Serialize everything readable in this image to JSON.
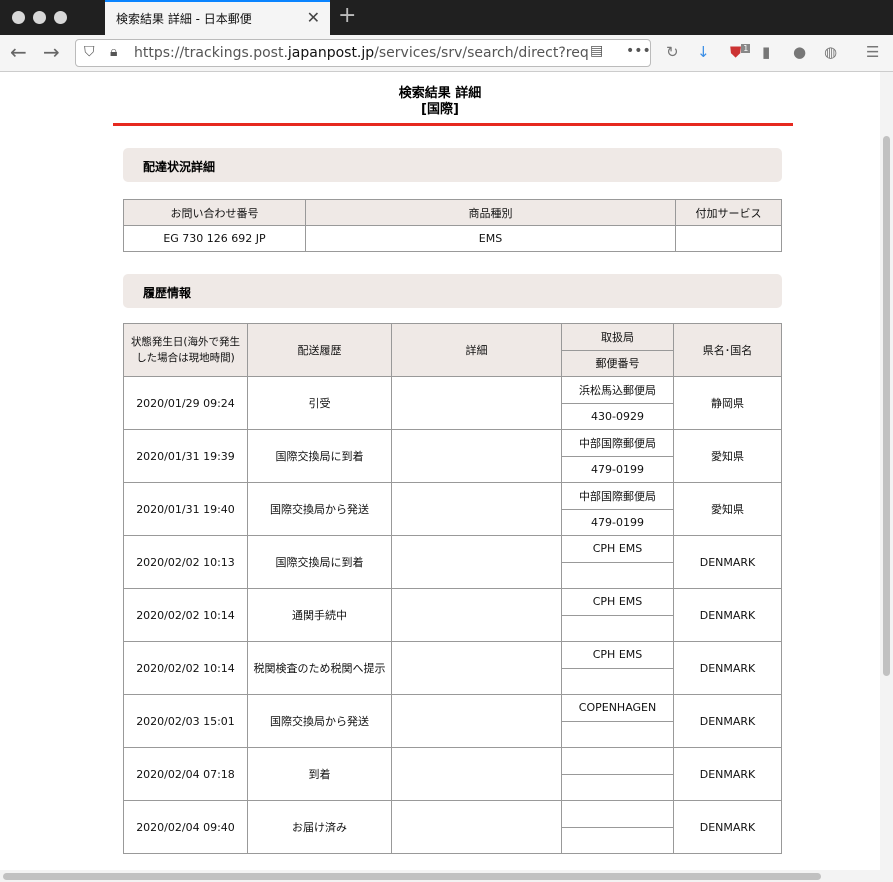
{
  "browser": {
    "tab_title": "検索結果 詳細 - 日本郵便",
    "url_host": "https://trackings.post.",
    "url_domain": "japanpost.jp",
    "url_path": "/services/srv/search/direct?req",
    "badge": "1"
  },
  "page": {
    "title": "検索結果 詳細",
    "subtitle": "[国際]"
  },
  "delivery": {
    "heading": "配達状況詳細",
    "headers": [
      "お問い合わせ番号",
      "商品種別",
      "付加サービス"
    ],
    "row": [
      "EG 730 126 692 JP",
      "EMS",
      ""
    ]
  },
  "history": {
    "heading": "履歴情報",
    "headers": {
      "date": "状態発生日(海外で発生した場合は現地時間)",
      "status": "配送履歴",
      "detail": "詳細",
      "office": "取扱局",
      "postal": "郵便番号",
      "region": "県名･国名"
    },
    "rows": [
      {
        "date": "2020/01/29 09:24",
        "status": "引受",
        "detail": "",
        "office": "浜松馬込郵便局",
        "postal": "430-0929",
        "region": "静岡県"
      },
      {
        "date": "2020/01/31 19:39",
        "status": "国際交換局に到着",
        "detail": "",
        "office": "中部国際郵便局",
        "postal": "479-0199",
        "region": "愛知県"
      },
      {
        "date": "2020/01/31 19:40",
        "status": "国際交換局から発送",
        "detail": "",
        "office": "中部国際郵便局",
        "postal": "479-0199",
        "region": "愛知県"
      },
      {
        "date": "2020/02/02 10:13",
        "status": "国際交換局に到着",
        "detail": "",
        "office": "CPH EMS",
        "postal": "",
        "region": "DENMARK"
      },
      {
        "date": "2020/02/02 10:14",
        "status": "通関手続中",
        "detail": "",
        "office": "CPH EMS",
        "postal": "",
        "region": "DENMARK"
      },
      {
        "date": "2020/02/02 10:14",
        "status": "税関検査のため税関へ提示",
        "detail": "",
        "office": "CPH EMS",
        "postal": "",
        "region": "DENMARK"
      },
      {
        "date": "2020/02/03 15:01",
        "status": "国際交換局から発送",
        "detail": "",
        "office": "COPENHAGEN",
        "postal": "",
        "region": "DENMARK"
      },
      {
        "date": "2020/02/04 07:18",
        "status": "到着",
        "detail": "",
        "office": "",
        "postal": "",
        "region": "DENMARK"
      },
      {
        "date": "2020/02/04 09:40",
        "status": "お届け済み",
        "detail": "",
        "office": "",
        "postal": "",
        "region": "DENMARK"
      }
    ]
  }
}
